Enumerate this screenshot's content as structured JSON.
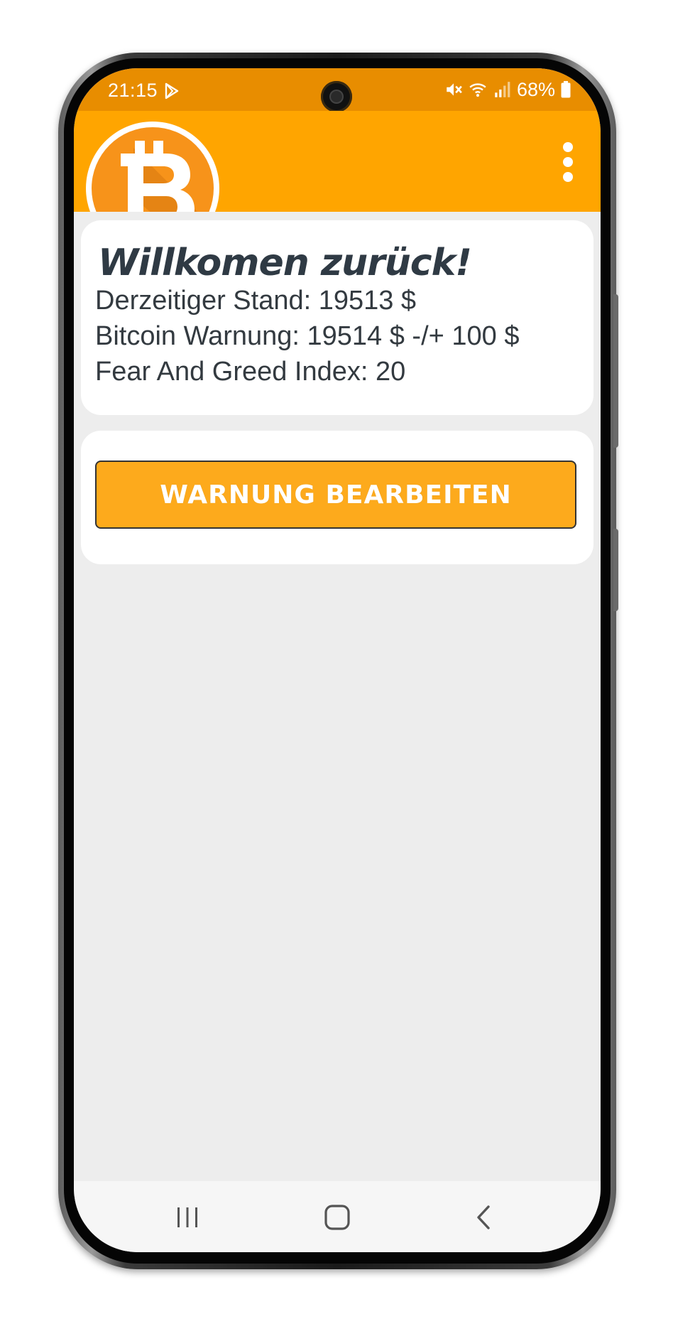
{
  "status_bar": {
    "time": "21:15",
    "battery": "68%",
    "icons": [
      "play-store-icon",
      "mute-icon",
      "wifi-icon",
      "signal-icon",
      "battery-icon"
    ]
  },
  "app_bar": {
    "logo_icon": "bitcoin-logo",
    "menu_icon": "more-vert-icon",
    "color": "#ffa500"
  },
  "info_card": {
    "title": "Willkomen zurück!",
    "current_price": "Derzeitiger Stand: 19513 $",
    "alert": "Bitcoin Warnung: 19514 $ -/+ 100 $",
    "fear_greed": "Fear And Greed Index: 20"
  },
  "actions": {
    "edit_warning_label": "WARNUNG BEARBEITEN",
    "button_color": "#fdaa1c"
  },
  "nav_bar": {
    "icons": [
      "recents-icon",
      "home-icon",
      "back-icon"
    ]
  }
}
